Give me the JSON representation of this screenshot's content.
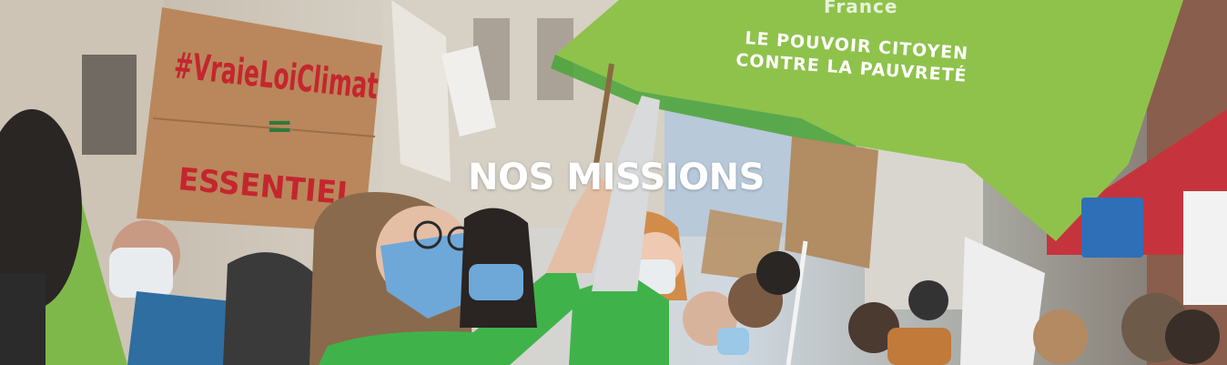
{
  "hero": {
    "title": "NOS MISSIONS",
    "cardboard_sign": {
      "hashtag": "#VraieLoiClimat",
      "symbol": "=",
      "word": "ESSENTIEL"
    },
    "banner": {
      "org": "France",
      "line1": "LE POUVOIR CITOYEN",
      "line2": "CONTRE LA PAUVRETÉ"
    },
    "colors": {
      "banner_green": "#8fc24b",
      "jacket_green": "#3fb34a",
      "mask_blue": "#6ea8d8",
      "sign_ink": "#c4262e"
    }
  }
}
